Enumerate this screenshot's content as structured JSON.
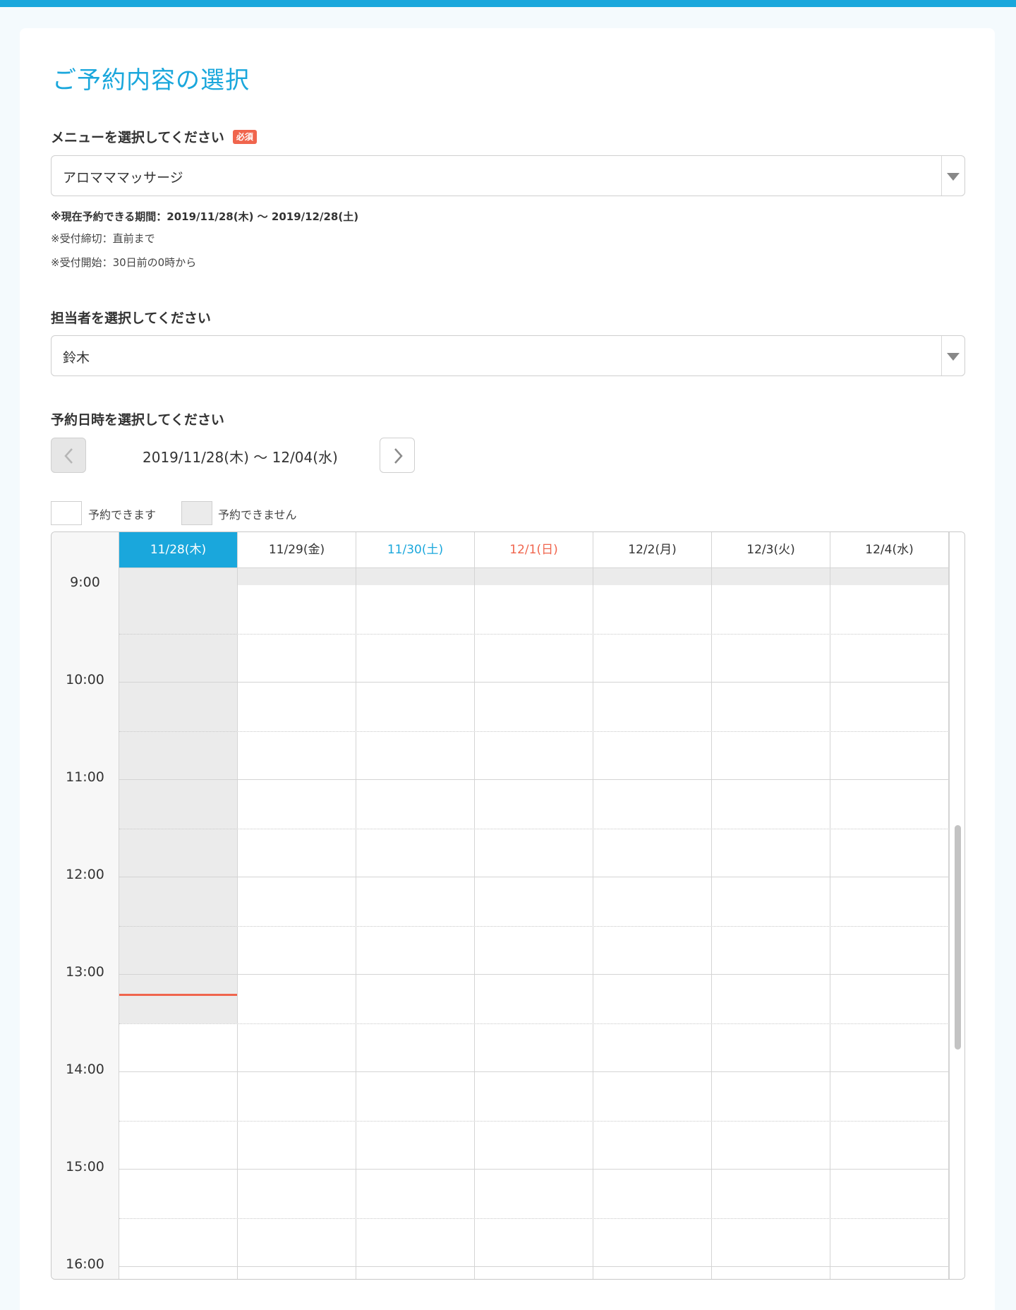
{
  "page": {
    "title": "ご予約内容の選択",
    "accent_color": "#1aa7dc",
    "required_color": "#f0654d"
  },
  "menu_field": {
    "label": "メニューを選択してください",
    "required_badge": "必須",
    "value": "アロマママッサージ",
    "notes": [
      "※現在予約できる期間：2019/11/28(木) 〜 2019/12/28(土)",
      "※受付締切：直前まで",
      "※受付開始：30日前の0時から"
    ]
  },
  "staff_field": {
    "label": "担当者を選択してください",
    "value": "鈴木"
  },
  "datetime_field": {
    "label": "予約日時を選択してください",
    "range": "2019/11/28(木) 〜 12/04(水)",
    "prev_icon": "chevron-left-icon",
    "next_icon": "chevron-right-icon"
  },
  "legend": {
    "available": "予約できます",
    "unavailable": "予約できません"
  },
  "calendar": {
    "days": [
      "11/28(木)",
      "11/29(金)",
      "11/30(土)",
      "12/1(日)",
      "12/2(月)",
      "12/3(火)",
      "12/4(水)"
    ],
    "times": [
      "9:00",
      "10:00",
      "11:00",
      "12:00",
      "13:00",
      "14:00",
      "15:00",
      "16:00"
    ]
  }
}
